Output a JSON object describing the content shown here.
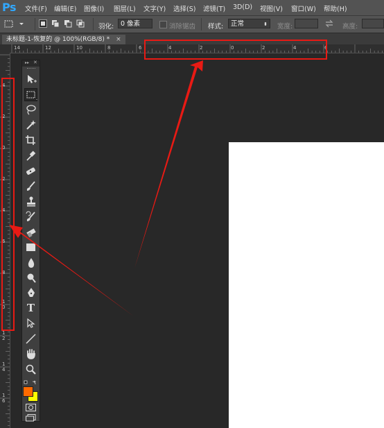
{
  "app": {
    "logo": "Ps"
  },
  "menu": {
    "items": [
      "文件(F)",
      "编辑(E)",
      "图像(I)",
      "图层(L)",
      "文字(Y)",
      "选择(S)",
      "滤镜(T)",
      "3D(D)",
      "视图(V)",
      "窗口(W)",
      "帮助(H)"
    ]
  },
  "options": {
    "feather_label": "羽化:",
    "feather_value": "0 像素",
    "antialias_label": "消除锯齿",
    "style_label": "样式:",
    "style_value": "正常",
    "width_label": "宽度:",
    "height_label": "高度:"
  },
  "document": {
    "tab_title": "未标题-1-恢复的 @ 100%(RGB/8) *",
    "close_symbol": "×"
  },
  "rulers": {
    "horizontal_labels": [
      "14",
      "12",
      "10",
      "8",
      "6",
      "4",
      "2",
      "0",
      "2",
      "4",
      "6"
    ],
    "vertical_labels": [
      "4",
      "2",
      "0",
      "2",
      "4",
      "6",
      "8",
      "1 0",
      "1 2",
      "1 4",
      "1 6"
    ]
  },
  "tools": {
    "type_tool_glyph": "T",
    "list": [
      "move-tool",
      "rectangular-marquee-tool",
      "lasso-tool",
      "quick-selection-tool",
      "crop-tool",
      "eyedropper-tool",
      "spot-healing-brush-tool",
      "brush-tool",
      "clone-stamp-tool",
      "history-brush-tool",
      "eraser-tool",
      "paint-bucket-tool",
      "blur-tool",
      "dodge-tool",
      "pen-tool",
      "type-tool",
      "path-selection-tool",
      "line-tool",
      "hand-tool",
      "zoom-tool"
    ]
  },
  "colors": {
    "foreground": "#ff6a00",
    "background": "#ffff00",
    "annotation": "#e81a14",
    "accent": "#31a8ff"
  }
}
